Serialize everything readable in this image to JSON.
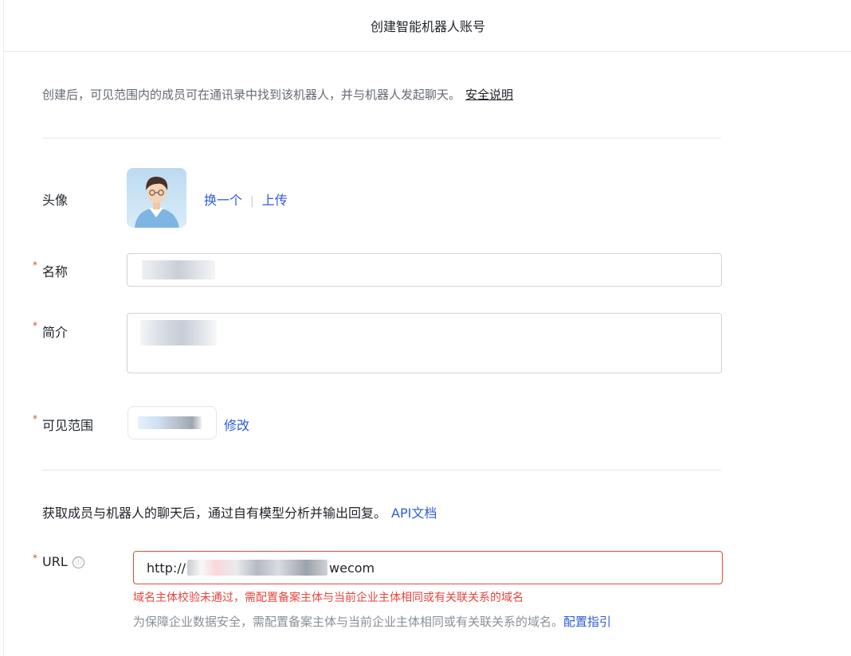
{
  "header": {
    "title": "创建智能机器人账号"
  },
  "intro": {
    "text": "创建后，可见范围内的成员可在通讯录中找到该机器人，并与机器人发起聊天。",
    "link": "安全说明"
  },
  "avatar_row": {
    "label": "头像",
    "change_link": "换一个",
    "separator": "|",
    "upload_link": "上传"
  },
  "name_row": {
    "required_mark": "*",
    "label": "名称"
  },
  "desc_row": {
    "required_mark": "*",
    "label": "简介"
  },
  "scope_row": {
    "required_mark": "*",
    "label": "可见范围",
    "edit_link": "修改"
  },
  "api_section": {
    "text": "获取成员与机器人的聊天后，通过自有模型分析并输出回复。",
    "link": "API文档"
  },
  "url_row": {
    "required_mark": "*",
    "label": "URL",
    "info_icon": "ⓘ",
    "value_prefix": "http://",
    "value_suffix": "wecom",
    "error": "域名主体校验未通过，需配置备案主体与当前企业主体相同或有关联关系的域名",
    "hint": "为保障企业数据安全，需配置备案主体与当前企业主体相同或有关联关系的域名。",
    "hint_link": "配置指引"
  },
  "colors": {
    "link": "#2f5bd4",
    "error": "#e8453c",
    "border": "#d0d3d6"
  }
}
